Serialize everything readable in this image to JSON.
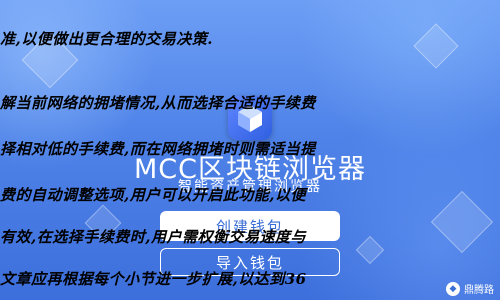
{
  "overlay_text": [
    "准,以便做出更合理的交易决策.",
    "解当前网络的拥堵情况,从而选择合适的手续费",
    "择相对低的手续费,而在网络拥堵时则需适当提",
    "费的自动调整选项,用户可以开启此功能,以便",
    "有效,在选择手续费时,用户需权衡交易速度与",
    "文章应再根据每个小节进一步扩展,以达到36"
  ],
  "app": {
    "title": "MCC区块链浏览器",
    "subtitle": "智能资产管理浏览器",
    "logo_icon": "blockchain-cube-icon"
  },
  "buttons": {
    "create": "创建钱包",
    "import": "导入钱包"
  },
  "watermark": {
    "label": "鼎腾路",
    "icon": "watermark-logo-icon"
  },
  "colors": {
    "background": "#4f83e8",
    "button_text": "#3b6fd6"
  }
}
